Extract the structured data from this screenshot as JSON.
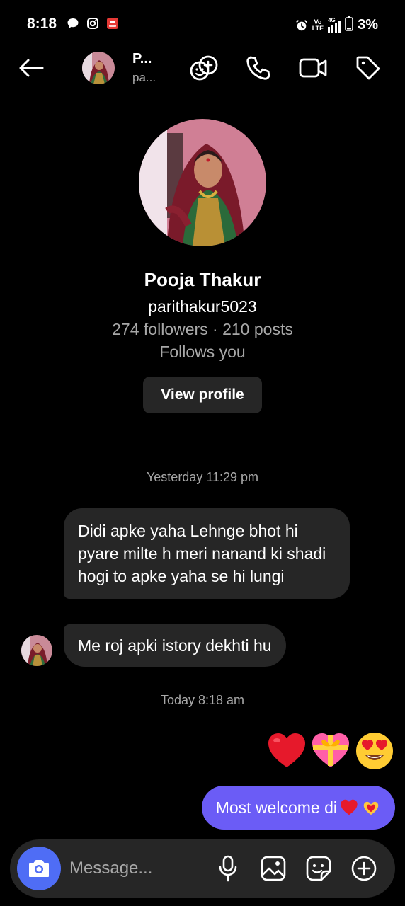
{
  "status_bar": {
    "time": "8:18",
    "battery": "3%",
    "volte_top": "Vo",
    "volte_bottom": "LTE",
    "network": "4G",
    "icons": [
      "chat-bubble-icon",
      "instagram-icon",
      "pdf-app-icon",
      "alarm-icon",
      "signal-icon",
      "battery-icon"
    ]
  },
  "header": {
    "name": "P...",
    "username": "pa...",
    "buttons": [
      "back-arrow-icon",
      "add-people-icon",
      "phone-icon",
      "video-camera-icon",
      "tag-icon"
    ]
  },
  "profile": {
    "name": "Pooja Thakur",
    "username": "parithakur5023",
    "stats": "274 followers · 210 posts",
    "follows": "Follows you",
    "view_profile_label": "View profile"
  },
  "conversation": {
    "timestamp_1": "Yesterday 11:29 pm",
    "messages_in": [
      {
        "text": "Didi apke yaha Lehnge bhot hi pyare milte h meri nanand ki shadi hogi to apke yaha se hi lungi"
      },
      {
        "text": "Me roj apki istory dekhti hu"
      }
    ],
    "timestamp_2": "Today 8:18 am",
    "emoji_message": [
      "red-heart",
      "heart-with-ribbon",
      "smiling-face-with-heart-eyes"
    ],
    "message_out": {
      "text": "Most welcome di",
      "emojis": [
        "red-heart",
        "heart-hands"
      ]
    }
  },
  "composer": {
    "placeholder": "Message...",
    "buttons": [
      "camera-icon",
      "microphone-icon",
      "gallery-icon",
      "sticker-icon",
      "plus-icon"
    ]
  },
  "colors": {
    "background": "#000000",
    "bubble_incoming": "#262626",
    "bubble_outgoing": "#6b5cf6",
    "camera_button": "#4f6df5",
    "secondary_text": "#a8a8a8"
  }
}
